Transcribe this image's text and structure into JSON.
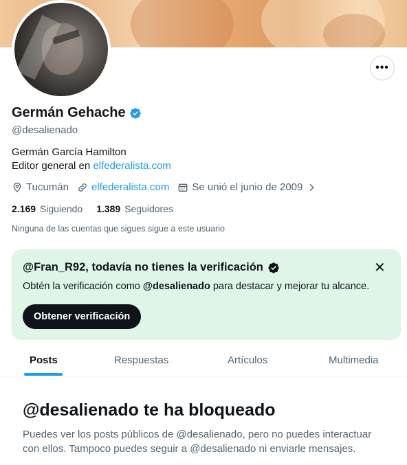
{
  "profile": {
    "name": "Germán Gehache",
    "handle": "@desalienado",
    "bio_line1": "Germán García Hamilton",
    "bio_line2_prefix": "Editor general en ",
    "bio_link": "elfederalista.com",
    "location": "Tucumán",
    "website": "elfederalista.com",
    "joined": "Se unió el junio de 2009",
    "following_count": "2.169",
    "following_label": "Siguiendo",
    "followers_count": "1.389",
    "followers_label": "Seguidores",
    "followers_note": "Ninguna de las cuentas que sigues sigue a este usuario"
  },
  "more_button": {
    "label": "•••"
  },
  "verification_prompt": {
    "title": "@Fran_R92, todavía no tienes la verificación",
    "text_prefix": "Obtén la verificación como ",
    "text_handle": "@desalienado",
    "text_suffix": " para destacar y mejorar tu alcance.",
    "button_label": "Obtener verificación",
    "close_label": "✕"
  },
  "tabs": [
    {
      "label": "Posts",
      "active": true
    },
    {
      "label": "Respuestas",
      "active": false
    },
    {
      "label": "Artículos",
      "active": false
    },
    {
      "label": "Multimedia",
      "active": false
    }
  ],
  "blocked": {
    "title": "@desalienado te ha bloqueado",
    "text": "Puedes ver los posts públicos de @desalienado, pero no puedes interactuar con ellos. Tampoco puedes seguir a @desalienado ni enviarle mensajes."
  },
  "colors": {
    "accent": "#1d9bf0",
    "secondary_text": "#536471",
    "verification_bg": "#def5e8",
    "button_dark": "#0f1419"
  },
  "icons": [
    "verified-badge-icon",
    "location-icon",
    "link-icon",
    "calendar-icon",
    "chevron-right-icon",
    "more-icon",
    "close-icon",
    "verified-check-icon"
  ]
}
